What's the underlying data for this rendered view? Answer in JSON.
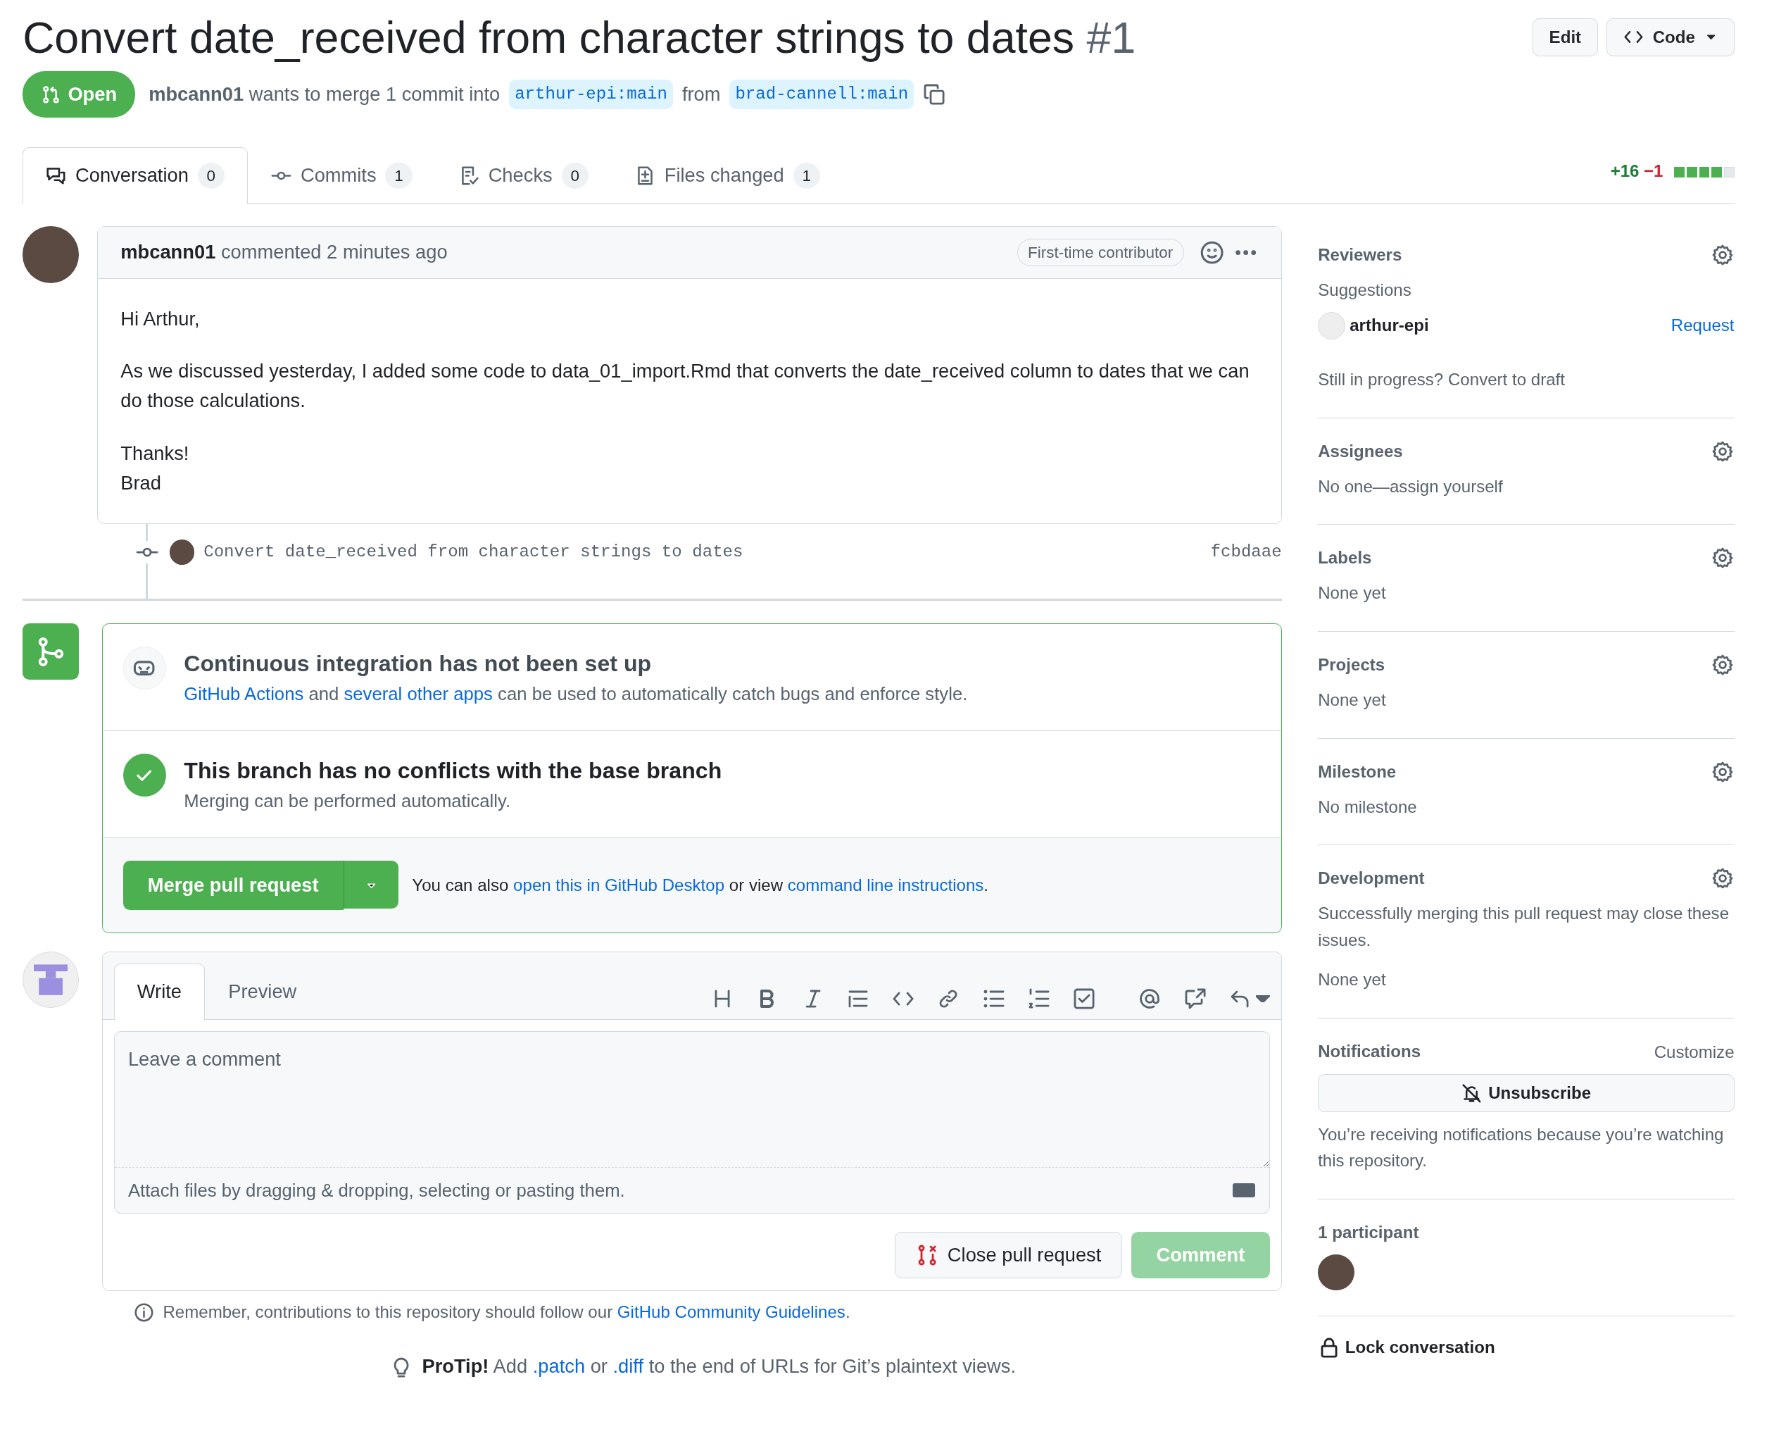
{
  "title": "Convert date_received from character strings to dates",
  "number": "#1",
  "header_buttons": [
    {
      "label": "Edit",
      "kind": "plain"
    },
    {
      "label": "Code",
      "kind": "code"
    }
  ],
  "state": "Open",
  "summary": {
    "author": "mbcann01",
    "text": "wants to merge 1 commit into",
    "base": "arthur-epi:main",
    "from": "from",
    "head": "brad-cannell:main"
  },
  "tabs": [
    {
      "label": "Conversation",
      "count": "0",
      "kind": "conversation",
      "selected": true
    },
    {
      "label": "Commits",
      "count": "1",
      "kind": "commits",
      "selected": false
    },
    {
      "label": "Checks",
      "count": "0",
      "kind": "checks",
      "selected": false
    },
    {
      "label": "Files changed",
      "count": "1",
      "kind": "files",
      "selected": false
    }
  ],
  "diffstat": {
    "added": "+16",
    "removed": "−1",
    "blocks": [
      {
        "kind": "added"
      },
      {
        "kind": "added"
      },
      {
        "kind": "added"
      },
      {
        "kind": "added"
      },
      {
        "kind": "neutral"
      }
    ]
  },
  "comment": {
    "author": "mbcann01",
    "action": "commented 2 minutes ago",
    "badge": "First-time contributor",
    "body": [
      [
        "Hi Arthur,"
      ],
      [
        "As we discussed yesterday, I added some code to data_01_import.Rmd that converts the date_received column to dates that we can do those calculations."
      ],
      [
        "Thanks!",
        "Brad"
      ]
    ]
  },
  "commit": {
    "message": "Convert date_received from character strings to dates",
    "sha": "fcbdaae"
  },
  "merge_box": {
    "ci_title": "Continuous integration has not been set up",
    "ci_text": [
      {
        "text": "GitHub Actions",
        "link": true
      },
      {
        "text": " and ",
        "link": false
      },
      {
        "text": "several other apps",
        "link": true
      },
      {
        "text": " can be used to automatically catch bugs and enforce style.",
        "link": false
      }
    ],
    "conflicts_title": "This branch has no conflicts with the base branch",
    "conflicts_text": "Merging can be performed automatically.",
    "merge_button": "Merge pull request",
    "alt_text": [
      {
        "text": "You can also ",
        "link": false
      },
      {
        "text": "open this in GitHub Desktop",
        "link": true
      },
      {
        "text": " or view ",
        "link": false
      },
      {
        "text": "command line instructions",
        "link": true
      },
      {
        "text": ".",
        "link": false
      }
    ]
  },
  "composer": {
    "tabs": [
      {
        "label": "Write",
        "selected": true
      },
      {
        "label": "Preview",
        "selected": false
      }
    ],
    "toolbar": [
      {
        "kind": "heading"
      },
      {
        "kind": "bold"
      },
      {
        "kind": "italic"
      },
      {
        "kind": "quote"
      },
      {
        "kind": "code"
      },
      {
        "kind": "link"
      },
      {
        "kind": "bullets"
      },
      {
        "kind": "numbers"
      },
      {
        "kind": "tasks"
      },
      {
        "kind": "mention"
      },
      {
        "kind": "reference"
      },
      {
        "kind": "reply"
      }
    ],
    "placeholder": "Leave a comment",
    "attach": "Attach files by dragging & dropping, selecting or pasting them.",
    "close_button": "Close pull request",
    "comment_button": "Comment",
    "comment_disabled": true
  },
  "guidelines": [
    {
      "text": "Remember, contributions to this repository should follow our ",
      "link": false
    },
    {
      "text": "GitHub Community Guidelines",
      "link": true
    },
    {
      "text": ".",
      "link": false
    }
  ],
  "protip": [
    {
      "text": "ProTip!",
      "kind": "bold"
    },
    {
      "text": " Add ",
      "kind": "plain"
    },
    {
      "text": ".patch",
      "kind": "link"
    },
    {
      "text": " or ",
      "kind": "plain"
    },
    {
      "text": ".diff",
      "kind": "link"
    },
    {
      "text": " to the end of URLs for Git’s plaintext views.",
      "kind": "plain"
    }
  ],
  "sidebar": {
    "reviewers": {
      "heading": "Reviewers",
      "suggestions": "Suggestions",
      "reviewer": "arthur-epi",
      "request": "Request",
      "draft": "Still in progress? Convert to draft"
    },
    "sections": [
      {
        "heading": "Assignees",
        "lines": [
          "No one—assign yourself"
        ]
      },
      {
        "heading": "Labels",
        "lines": [
          "None yet"
        ]
      },
      {
        "heading": "Projects",
        "lines": [
          "None yet"
        ]
      },
      {
        "heading": "Milestone",
        "lines": [
          "No milestone"
        ]
      },
      {
        "heading": "Development",
        "lines": [
          "Successfully merging this pull request may close these issues.",
          "None yet"
        ]
      }
    ],
    "notifications": {
      "heading": "Notifications",
      "customize": "Customize",
      "button": "Unsubscribe",
      "text": "You’re receiving notifications because you’re watching this repository."
    },
    "participants": "1 participant",
    "lock": "Lock conversation"
  }
}
